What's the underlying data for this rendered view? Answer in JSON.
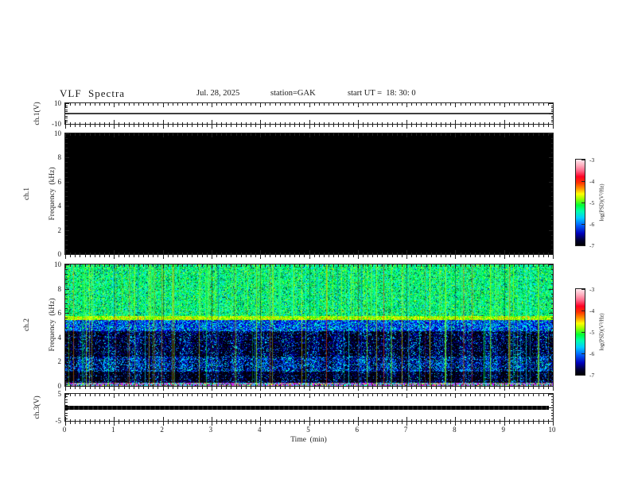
{
  "header": {
    "title": "VLF  Spectra",
    "date": "Jul. 28, 2025",
    "station": "station=GAK",
    "start_ut": "start UT =  18: 30: 0"
  },
  "colormap_stops": [
    [
      "#000000",
      0
    ],
    [
      "#000033",
      6
    ],
    [
      "#0000bb",
      14
    ],
    [
      "#0066ff",
      24
    ],
    [
      "#00ccff",
      32
    ],
    [
      "#00ffaa",
      40
    ],
    [
      "#00ff33",
      47
    ],
    [
      "#99ff00",
      54
    ],
    [
      "#ffff00",
      60
    ],
    [
      "#ff9900",
      66
    ],
    [
      "#ff3300",
      73
    ],
    [
      "#ff0022",
      80
    ],
    [
      "#ff6688",
      87
    ],
    [
      "#ffaabb",
      93
    ],
    [
      "#ffe8ee",
      100
    ]
  ],
  "chart_data": [
    {
      "type": "line",
      "name": "ch1-voltage",
      "ylabel": "ch.1(V)",
      "ylim": [
        -10,
        10
      ],
      "ytick_values": [
        10,
        -10
      ],
      "ytick_labels": [
        "10",
        "-10"
      ],
      "xlim": [
        0,
        10
      ],
      "series": [
        {
          "name": "ch.1 waveform",
          "constant_value": 0,
          "color": "#3f3f3f",
          "description": "flat trace at 0 V across 0-10 min"
        }
      ]
    },
    {
      "type": "heatmap",
      "name": "ch1-spectrogram",
      "ylabel_lines": [
        "ch.1",
        "Frequency  (kHz)"
      ],
      "ylim": [
        0,
        10
      ],
      "ytick_values": [
        10,
        8,
        6,
        4,
        2,
        0
      ],
      "ytick_labels": [
        "10",
        "8",
        "6",
        "4",
        "2",
        "0"
      ],
      "xlim": [
        0,
        10
      ],
      "zlim": [
        -7,
        -3
      ],
      "colorbar_label": "log(PSD)(V²/Hz)",
      "colorbar_tick_labels": [
        "-3",
        "-4",
        "-5",
        "-6",
        "-7"
      ],
      "uniform_psd": -7,
      "background": "#000000",
      "description": "no signal: uniform minimum PSD, panel entirely black"
    },
    {
      "type": "heatmap",
      "name": "ch2-spectrogram",
      "ylabel_lines": [
        "ch.2",
        "Frequency  (kHz)"
      ],
      "ylim": [
        0,
        10
      ],
      "ytick_values": [
        10,
        8,
        6,
        4,
        2,
        0
      ],
      "ytick_labels": [
        "10",
        "8",
        "6",
        "4",
        "2",
        "0"
      ],
      "xlim": [
        0,
        10
      ],
      "zlim": [
        -7,
        -3
      ],
      "colorbar_label": "log(PSD)(V²/Hz)",
      "colorbar_tick_labels": [
        "-3",
        "-4",
        "-5",
        "-6",
        "-7"
      ],
      "seed": 7,
      "bands": [
        {
          "f": [
            0,
            0.25
          ],
          "psd": -4.5,
          "colors": [
            "#9090a0",
            "#cc00ff",
            "#00ffff",
            "#ffff00",
            "#ff00ff",
            "#8080ff",
            "#202020"
          ],
          "weights": [
            25,
            15,
            20,
            10,
            10,
            10,
            10
          ]
        },
        {
          "f": [
            0.25,
            1.2
          ],
          "psd": -6.8,
          "colors": [
            "#000006",
            "#000045",
            "#0000a8",
            "#0070ff",
            "#00e8ff"
          ],
          "weights": [
            45,
            28,
            15,
            7,
            5
          ],
          "blocky": true
        },
        {
          "f": [
            1.2,
            2.4
          ],
          "psd": -6.2,
          "colors": [
            "#000010",
            "#000088",
            "#0038ff",
            "#00b0ff",
            "#00ffff",
            "#00ff88"
          ],
          "weights": [
            22,
            24,
            24,
            15,
            10,
            5
          ],
          "blocky": true
        },
        {
          "f": [
            2.4,
            3.5
          ],
          "psd": -6.6,
          "colors": [
            "#000006",
            "#000050",
            "#0000c0",
            "#0090ff",
            "#00ffff"
          ],
          "weights": [
            36,
            28,
            20,
            9,
            7
          ],
          "blocky": true
        },
        {
          "f": [
            3.5,
            4.5
          ],
          "psd": -6.7,
          "colors": [
            "#000006",
            "#000060",
            "#0000d8",
            "#00a0ff",
            "#00ffff"
          ],
          "weights": [
            38,
            28,
            18,
            9,
            7
          ],
          "blocky": true
        },
        {
          "f": [
            4.5,
            5.4
          ],
          "psd": -6.0,
          "colors": [
            "#000080",
            "#0000ff",
            "#0080ff",
            "#00ffff",
            "#00ff60"
          ],
          "weights": [
            24,
            28,
            22,
            16,
            10
          ]
        },
        {
          "f": [
            5.4,
            5.75
          ],
          "psd": -4.6,
          "colors": [
            "#88ff00",
            "#c8ff00",
            "#ffff00",
            "#00ff00",
            "#ff8800"
          ],
          "weights": [
            30,
            25,
            18,
            17,
            10
          ]
        },
        {
          "f": [
            5.75,
            10
          ],
          "psd": -5.0,
          "colors": [
            "#00dd44",
            "#00ff66",
            "#44ff88",
            "#00ffcc",
            "#00c8ff",
            "#007733",
            "#bbff00",
            "#003366"
          ],
          "weights": [
            26,
            22,
            14,
            12,
            10,
            6,
            5,
            5
          ]
        }
      ],
      "streaks_full": {
        "count": 90,
        "colors": [
          "#ff3300",
          "#ff8800",
          "#ffff00",
          "#88ff00",
          "#00ff44",
          "#00ffff",
          "#0044ff"
        ],
        "weights": [
          10,
          8,
          12,
          25,
          25,
          12,
          8
        ],
        "alpha": [
          0.2,
          0.65
        ]
      },
      "streaks_upper": {
        "count": 130,
        "f_above": 5.6,
        "colors": [
          "#66ff44",
          "#00ff88",
          "#aaff00",
          "#00ffff"
        ],
        "weights": [
          35,
          30,
          20,
          15
        ],
        "alpha": [
          0.25,
          0.7
        ]
      },
      "minute_gridline_color": "rgba(0,10,20,0.4)",
      "description": "broadband noise: bright green 6-10 kHz, bright band at 5.5 kHz, blue/dark speckle below 5 kHz, colored sferic streaks"
    },
    {
      "type": "line",
      "name": "ch3-voltage",
      "ylabel": "ch.3(V)",
      "ylim": [
        -5,
        5
      ],
      "ytick_values": [
        5,
        -5
      ],
      "ytick_labels": [
        "5",
        "-5"
      ],
      "xlim": [
        0,
        10
      ],
      "xlabel": "Time  (min)",
      "xtick_values": [
        0,
        1,
        2,
        3,
        4,
        5,
        6,
        7,
        8,
        9,
        10
      ],
      "xtick_labels": [
        "0",
        "1",
        "2",
        "3",
        "4",
        "5",
        "6",
        "7",
        "8",
        "9",
        "10"
      ],
      "series": [
        {
          "name": "ch.3 waveform",
          "constant_value": 0,
          "color": "#0d0d0d",
          "description": "thick flat trace at 0 V from 0 to ~9.9 min"
        }
      ]
    }
  ]
}
